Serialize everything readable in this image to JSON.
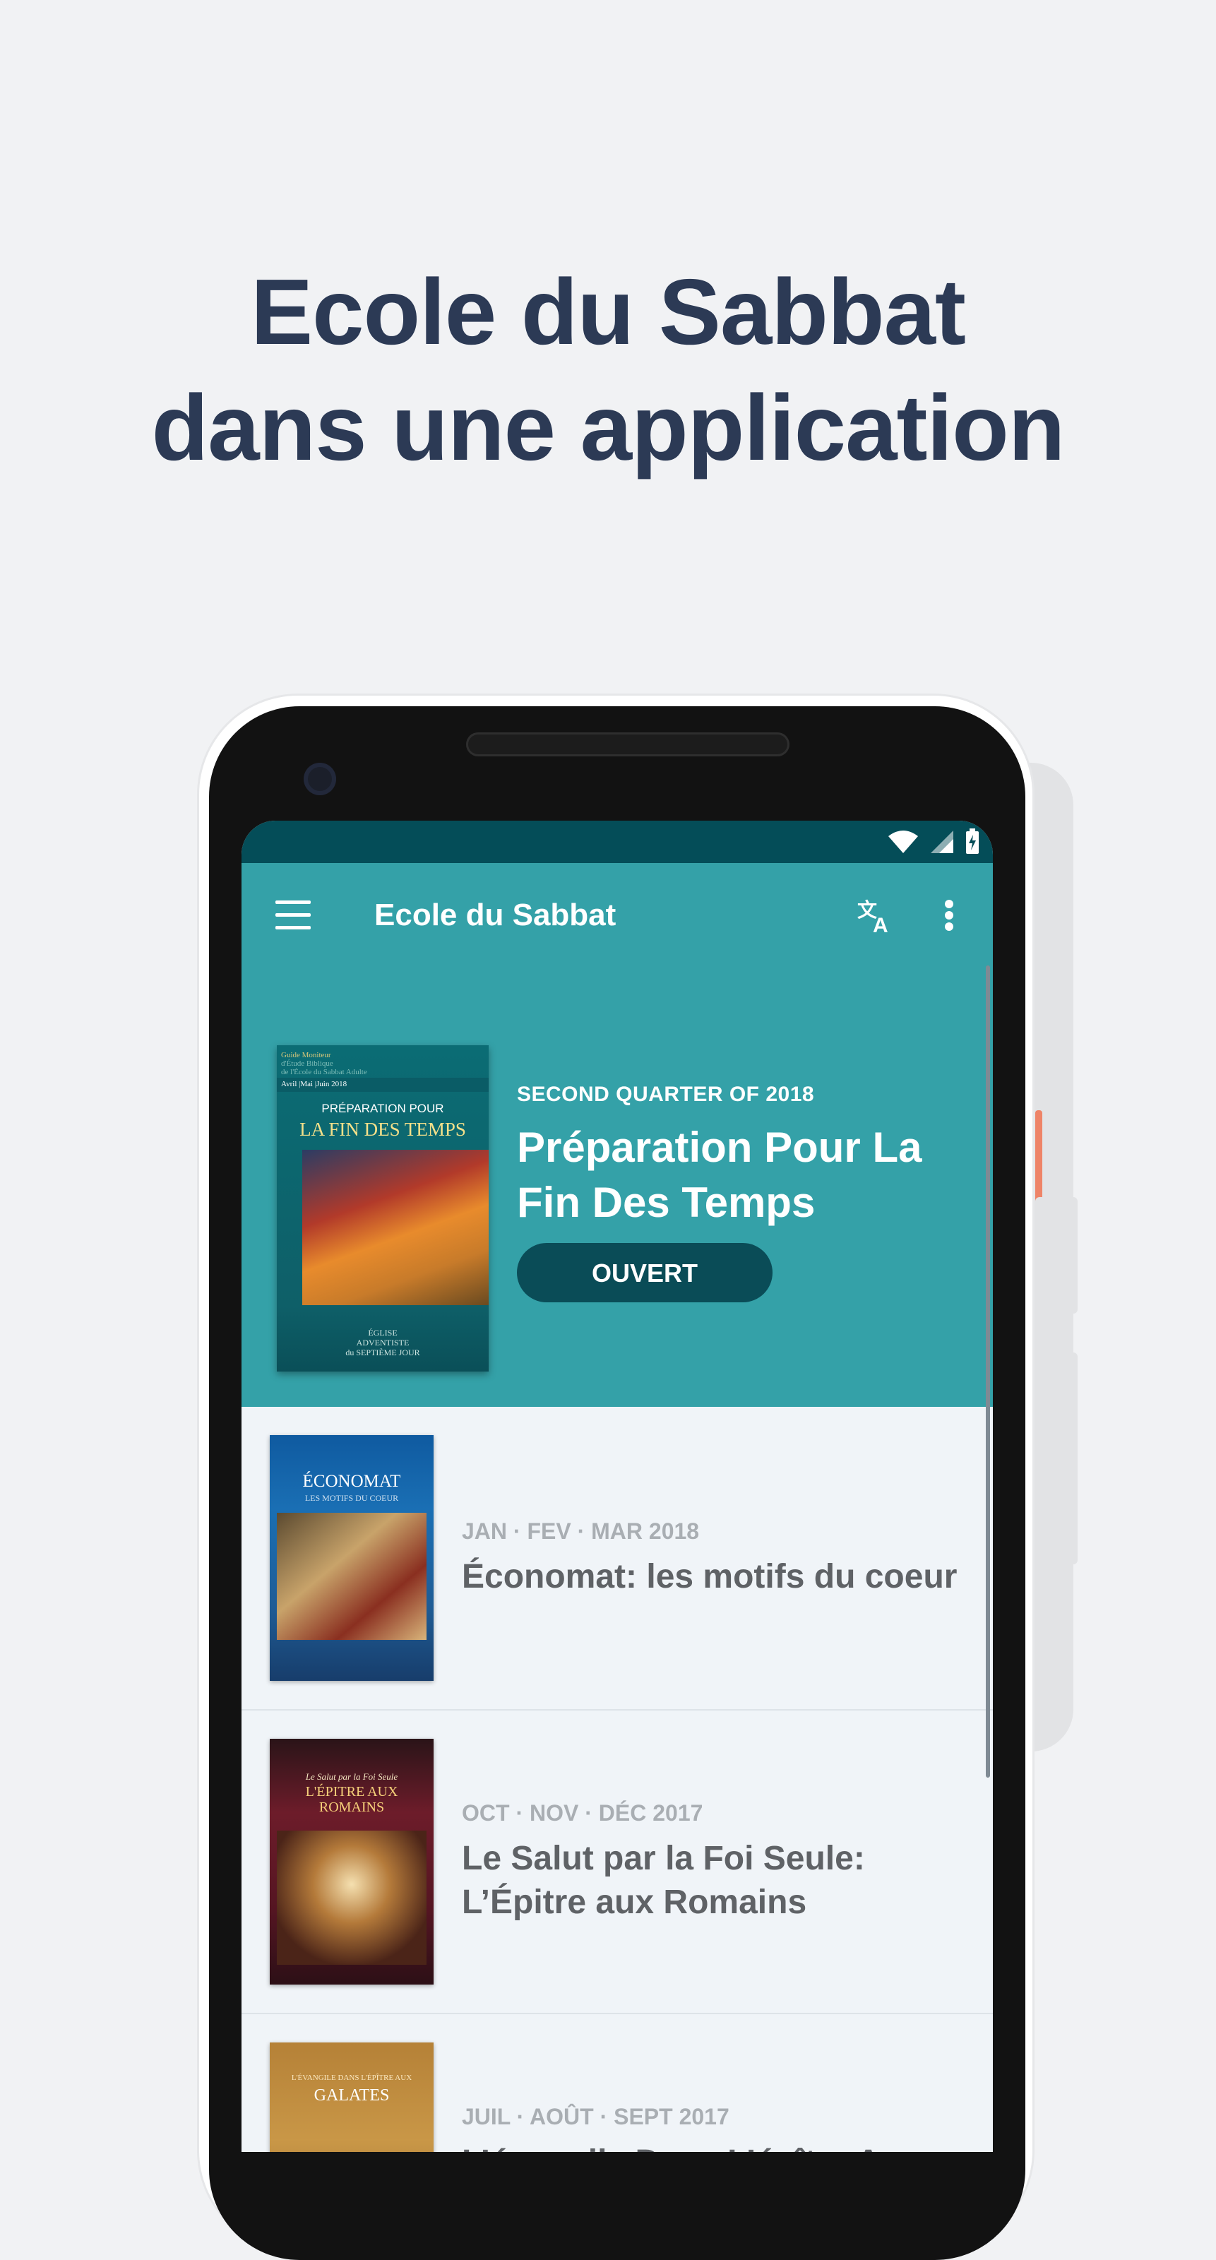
{
  "headline": {
    "line1": "Ecole du Sabbat",
    "line2": "dans une application"
  },
  "colors": {
    "primary": "#34a1a8",
    "primary_dark": "#044d58",
    "button": "#0a4c57",
    "headline": "#2c3a55",
    "background": "#f1f2f4"
  },
  "app_bar": {
    "title": "Ecole du Sabbat",
    "icons": [
      "menu-icon",
      "translate-icon",
      "more-vertical-icon"
    ]
  },
  "status_bar": {
    "icons": [
      "wifi-icon",
      "cellular-signal-icon",
      "battery-charging-icon"
    ]
  },
  "featured": {
    "date": "SECOND QUARTER OF 2018",
    "title": "Préparation Pour La Fin Des Temps",
    "button": "OUVERT",
    "cover": {
      "header_line1": "Guide Moniteur",
      "header_line2": "d'Étude Biblique",
      "header_line3": "de l'École du Sabbat Adulte",
      "dates": "Avril |Mai |Juin 2018",
      "subtitle": "PRÉPARATION POUR",
      "title": "LA FIN DES TEMPS",
      "logo_line1": "ÉGLISE",
      "logo_line2": "ADVENTISTE",
      "logo_line3": "du SEPTIÈME JOUR"
    }
  },
  "lessons": [
    {
      "date": "JAN · FEV · MAR 2018",
      "title": "Économat: les motifs du coeur",
      "cover_title": "ÉCONOMAT",
      "cover_subtitle": "LES MOTIFS DU COEUR"
    },
    {
      "date": "OCT · NOV · DÉC 2017",
      "title": "Le Salut par la Foi Seule: L’Épitre aux Romains",
      "cover_title": "L'ÉPITRE AUX ROMAINS",
      "cover_subtitle": "Le Salut par la Foi Seule"
    },
    {
      "date": "JUIL · AOÛT · SEPT 2017",
      "title": "L’évangile Dans L’épître Aux Galates",
      "cover_title": "GALATES",
      "cover_subtitle": "L'ÉVANGILE DANS L'ÉPÎTRE AUX"
    }
  ]
}
